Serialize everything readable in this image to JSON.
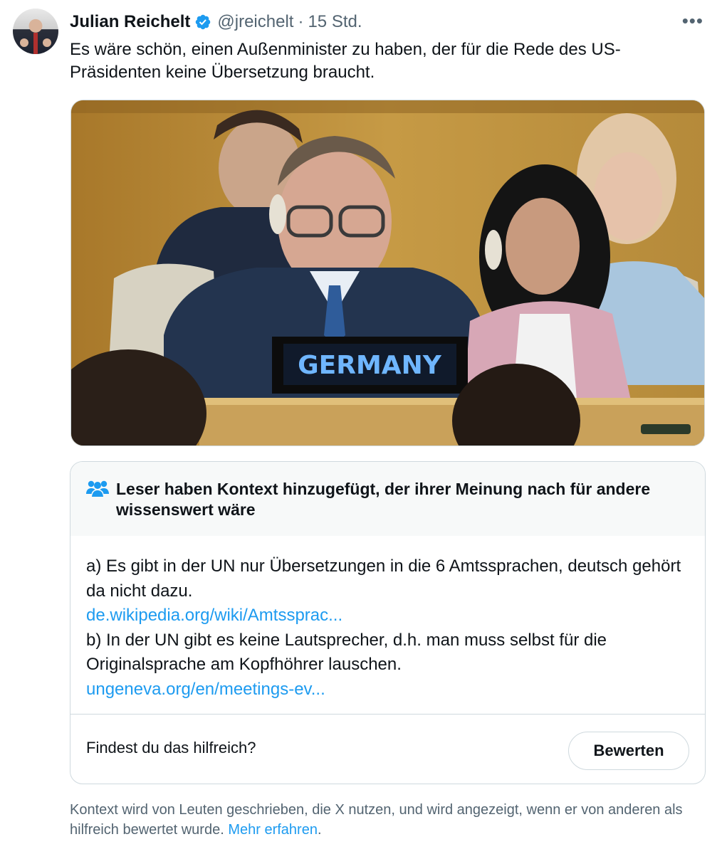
{
  "tweet": {
    "display_name": "Julian Reichelt",
    "handle": "@jreichelt",
    "separator": "·",
    "time": "15 Std.",
    "more_label": "•••",
    "text": "Es wäre schön, einen Außenminister zu haben, der für die Rede des US-Präsidenten keine Übersetzung braucht.",
    "media": {
      "nameplate": "GERMANY"
    }
  },
  "community_note": {
    "title": "Leser haben Kontext hinzugefügt, der ihrer Meinung nach für andere wissenswert wäre",
    "point_a": "a) Es gibt in der UN nur Übersetzungen in die 6 Amtssprachen, deutsch gehört da nicht dazu.",
    "link_a": "de.wikipedia.org/wiki/Amtssprac...",
    "point_b": "b) In der UN gibt es keine Lautsprecher, d.h. man muss selbst für die Originalsprache am Kopfhöhrer lauschen.",
    "link_b": "ungeneva.org/en/meetings-ev...",
    "question": "Findest du das hilfreich?",
    "rate_button": "Bewerten"
  },
  "footer": {
    "text": "Kontext wird von Leuten geschrieben, die X nutzen, und wird angezeigt, wenn er von anderen als hilfreich bewertet wurde.",
    "link": "Mehr erfahren",
    "period": "."
  },
  "colors": {
    "accent": "#1d9bf0",
    "secondary_text": "#536471",
    "border": "#cfd9de"
  },
  "icons": {
    "verified": "verified-badge-icon",
    "people": "community-people-icon",
    "more": "more-dots-icon"
  }
}
